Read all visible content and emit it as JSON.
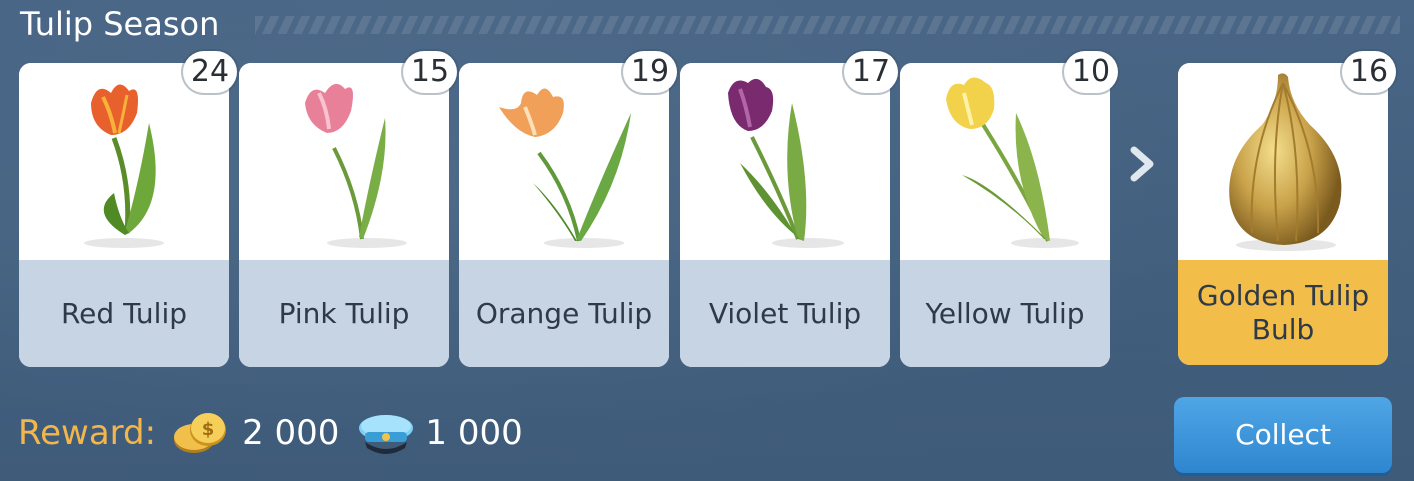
{
  "collection": {
    "title": "Tulip Season",
    "items": [
      {
        "name": "Red Tulip",
        "count": "24",
        "color": "#e8612d"
      },
      {
        "name": "Pink Tulip",
        "count": "15",
        "color": "#e8809a"
      },
      {
        "name": "Orange Tulip",
        "count": "19",
        "color": "#f0a058"
      },
      {
        "name": "Violet Tulip",
        "count": "17",
        "color": "#7a2a6e"
      },
      {
        "name": "Yellow Tulip",
        "count": "10",
        "color": "#f2d24a"
      }
    ],
    "reward_item": {
      "name": "Golden Tulip Bulb",
      "count": "16",
      "color": "#c9a24a"
    }
  },
  "reward": {
    "label": "Reward:",
    "coins": "2 000",
    "coins_icon": "coins-icon",
    "caps": "1 000",
    "caps_icon": "officer-cap-icon"
  },
  "collect_button": {
    "label": "Collect"
  },
  "colors": {
    "card_label_bg": "#c6d4e3",
    "reward_label_bg": "#f2bd48",
    "reward_text": "#f3b64a",
    "button": "#3a94d8"
  }
}
